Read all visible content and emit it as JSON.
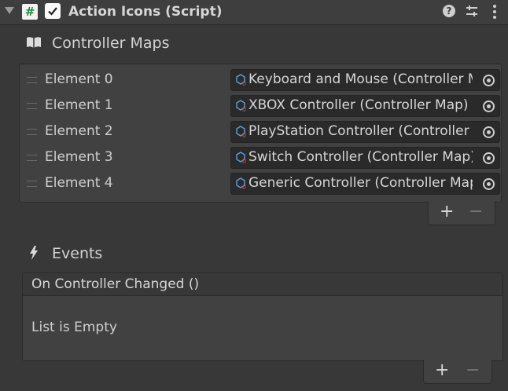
{
  "header": {
    "title": "Action Icons (Script)",
    "script_icon_glyph": "#",
    "enabled": true
  },
  "controller_maps": {
    "label": "Controller Maps",
    "elements": [
      {
        "label": "Element 0",
        "value": "Keyboard and Mouse (Controller Map)"
      },
      {
        "label": "Element 1",
        "value": "XBOX Controller (Controller Map)"
      },
      {
        "label": "Element 2",
        "value": "PlayStation Controller (Controller Map)"
      },
      {
        "label": "Element 3",
        "value": "Switch Controller (Controller Map)"
      },
      {
        "label": "Element 4",
        "value": "Generic Controller (Controller Map)"
      }
    ],
    "add_label": "+",
    "remove_label": "−"
  },
  "events": {
    "label": "Events",
    "event_header": "On Controller Changed ()",
    "empty_text": "List is Empty",
    "add_label": "+",
    "remove_label": "−"
  },
  "colors": {
    "background": "#383838",
    "header": "#3e3e3e",
    "field": "#2a2a2a",
    "script_icon_green": "#1e8a3c",
    "asset_icon_red": "#d04a3a",
    "asset_icon_blue": "#5fa0d6"
  }
}
